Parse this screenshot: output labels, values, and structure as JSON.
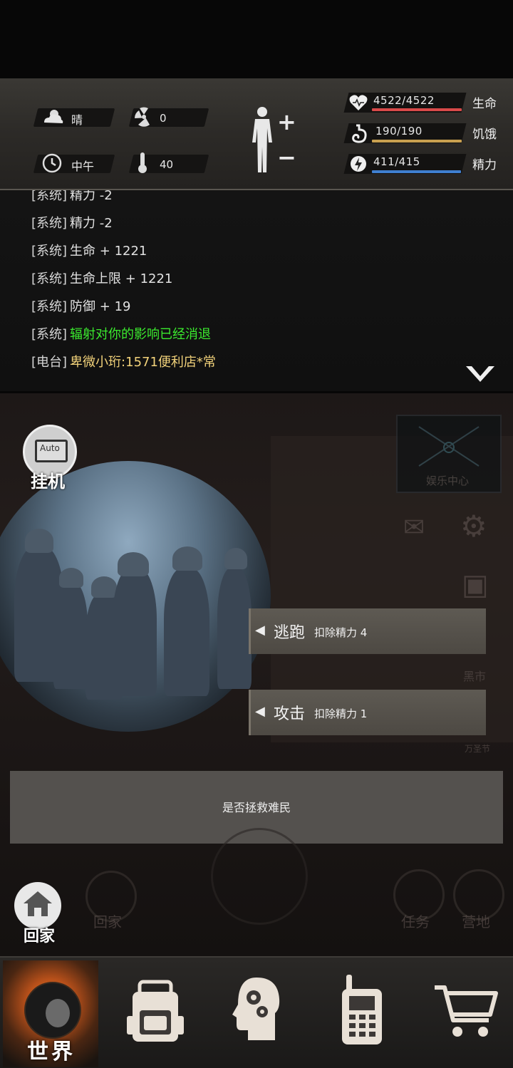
{
  "hud": {
    "weather": {
      "icon": "cloud-sun-icon",
      "label": "晴"
    },
    "radiation": {
      "icon": "radiation-icon",
      "value": "0"
    },
    "time": {
      "icon": "clock-icon",
      "label": "中午"
    },
    "temperature": {
      "icon": "thermometer-icon",
      "value": "40"
    },
    "body_controls": {
      "plus": "+",
      "minus": "−"
    },
    "stats": [
      {
        "key": "health",
        "icon": "heart-icon",
        "value": "4522/4522",
        "label": "生命",
        "fill": 1.0,
        "color": "#d94a4a"
      },
      {
        "key": "hunger",
        "icon": "stomach-icon",
        "value": "190/190",
        "label": "饥饿",
        "fill": 1.0,
        "color": "#c8a050"
      },
      {
        "key": "energy",
        "icon": "energy-icon",
        "value": "411/415",
        "label": "精力",
        "fill": 0.99,
        "color": "#3f7fd0"
      }
    ]
  },
  "log": {
    "lines": [
      {
        "tag": "[系统]",
        "msg": "精力 -2",
        "color": "white"
      },
      {
        "tag": "[系统]",
        "msg": "精力 -2",
        "color": "white"
      },
      {
        "tag": "[系统]",
        "msg": "生命 + 1221",
        "color": "white"
      },
      {
        "tag": "[系统]",
        "msg": "生命上限 + 1221",
        "color": "white"
      },
      {
        "tag": "[系统]",
        "msg": "防御 + 19",
        "color": "white"
      },
      {
        "tag": "[系统]",
        "msg": "辐射对你的影响已经消退",
        "color": "green"
      },
      {
        "tag": "[电台]",
        "msg": "卑微小珩:1571便利店*常",
        "color": "yellow"
      }
    ],
    "expand_icon": "chevron-down-icon"
  },
  "scene": {
    "auto_label": "Auto",
    "auto_caption": "挂机",
    "entertainment_label": "娱乐中心",
    "black_market_label": "黑市",
    "halloween_label": "万圣节",
    "actions": [
      {
        "key": "flee",
        "label": "逃跑",
        "cost": "扣除精力 4"
      },
      {
        "key": "attack",
        "label": "攻击",
        "cost": "扣除精力 1"
      }
    ],
    "prompt": "是否拯救难民",
    "home_label": "回家",
    "home_faded_label": "回家",
    "task_label": "任务",
    "camp_label": "营地"
  },
  "nav": {
    "world_label": "世界",
    "items": [
      {
        "key": "backpack",
        "icon": "backpack-icon"
      },
      {
        "key": "skills",
        "icon": "brain-gears-icon"
      },
      {
        "key": "radio",
        "icon": "walkie-talkie-icon"
      },
      {
        "key": "shop",
        "icon": "shopping-cart-icon"
      }
    ]
  }
}
